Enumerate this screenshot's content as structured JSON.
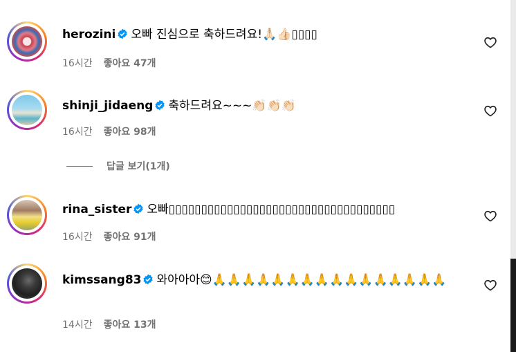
{
  "comments": [
    {
      "username": "herozini",
      "text": "오빠 진심으로 축하드려요!🙏🏻👍🏻▯▯▯▯",
      "time": "16시간",
      "likes": "좋아요 47개"
    },
    {
      "username": "shinji_jidaeng",
      "text": "축하드려요~~~👏🏻👏🏻👏🏻",
      "time": "16시간",
      "likes": "좋아요 98개"
    },
    {
      "username": "rina_sister",
      "text": "오빠▯▯▯▯▯▯▯▯▯▯▯▯▯▯▯▯▯▯▯▯▯▯▯▯▯▯▯▯▯▯▯▯▯▯▯",
      "time": "16시간",
      "likes": "좋아요 91개"
    },
    {
      "username": "kimssang83",
      "text": "와아아아😊🙏🙏🙏🙏🙏🙏🙏🙏🙏🙏🙏🙏🙏🙏🙏🙏",
      "time": "14시간",
      "likes": "좋아요 13개"
    }
  ],
  "replies": {
    "label": "답글 보기(1개)"
  },
  "colors": {
    "verified": "#0095f6",
    "meta": "#737373"
  },
  "icons": {
    "verified": "verified-badge-icon",
    "like": "heart-outline-icon"
  }
}
